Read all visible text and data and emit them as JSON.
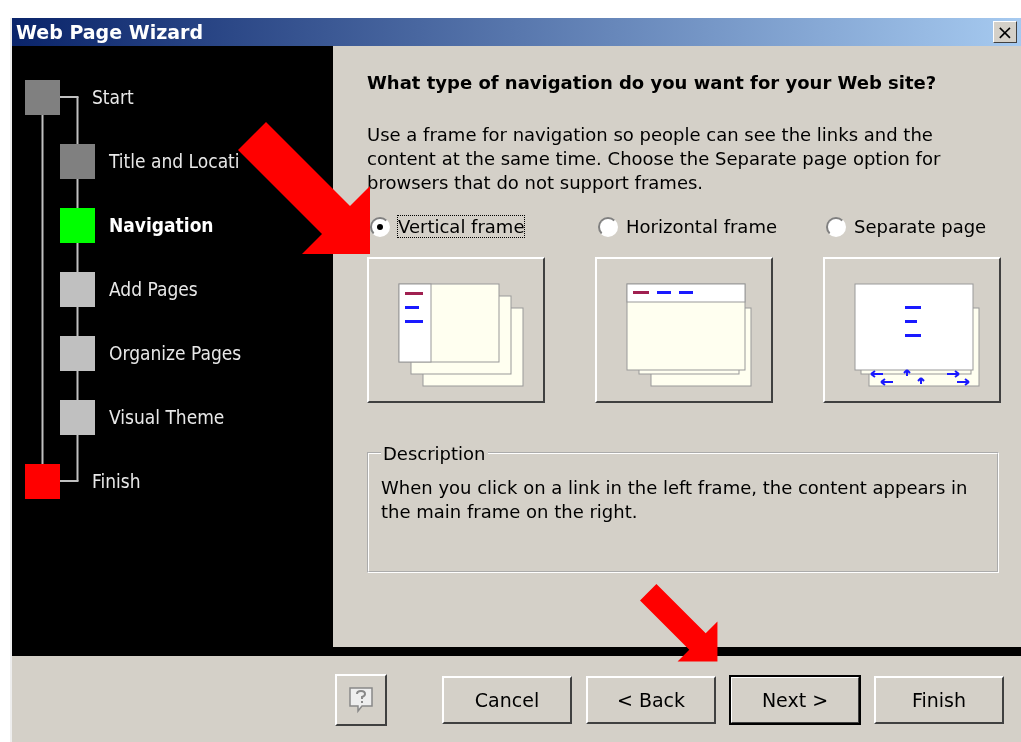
{
  "window": {
    "title": "Web Page Wizard",
    "close": "×"
  },
  "steps": [
    {
      "label": "Start",
      "color": "#808080",
      "selected": false,
      "children": [
        {
          "label": "Title and Locati",
          "color": "#808080",
          "selected": false
        },
        {
          "label": "Navigation",
          "color": "#00ff00",
          "selected": true
        },
        {
          "label": "Add Pages",
          "color": "#c0c0c0",
          "selected": false
        },
        {
          "label": "Organize Pages",
          "color": "#c0c0c0",
          "selected": false
        },
        {
          "label": "Visual Theme",
          "color": "#c0c0c0",
          "selected": false
        }
      ]
    },
    {
      "label": "Finish",
      "color": "#ff0000",
      "selected": false
    }
  ],
  "heading": "What type of navigation do you want for your Web site?",
  "intro": "Use a frame for navigation so people can see the links and the content at the same time.  Choose the Separate page option for browsers that do not support frames.",
  "options": [
    {
      "label": "Vertical frame",
      "kind": "vertical",
      "selected": true
    },
    {
      "label": "Horizontal frame",
      "kind": "horizontal",
      "selected": false
    },
    {
      "label": "Separate page",
      "kind": "separate",
      "selected": false
    }
  ],
  "description": {
    "legend": "Description",
    "text": "When you click on a link in the left frame, the content appears in the main frame on the right."
  },
  "buttons": [
    {
      "label": "Cancel",
      "default": false
    },
    {
      "label": "< Back",
      "default": false
    },
    {
      "label": "Next >",
      "default": true
    },
    {
      "label": "Finish",
      "default": false
    }
  ]
}
